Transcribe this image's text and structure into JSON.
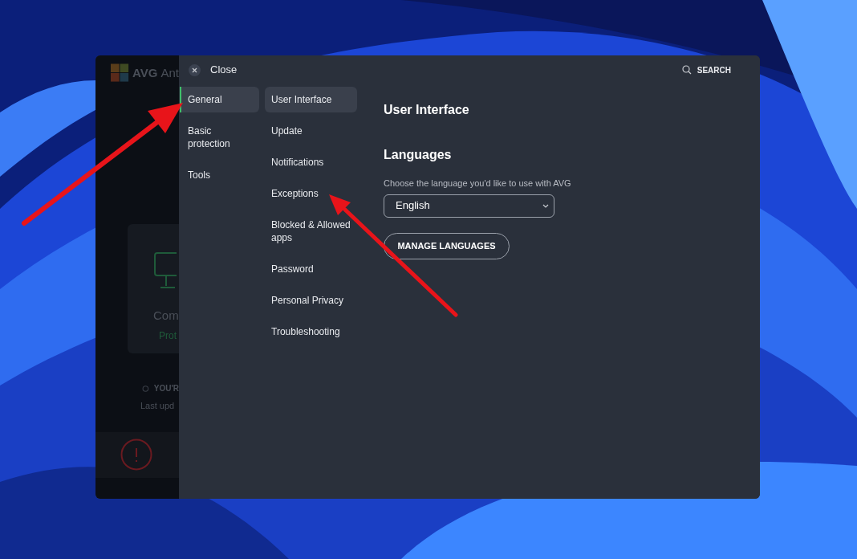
{
  "background_app": {
    "logo_text": "AVG",
    "title": "Ant",
    "status_title": "Com",
    "status_subtitle": "Prot",
    "update_status": "YOU'R",
    "last_update": "Last upd"
  },
  "header": {
    "close_label": "Close",
    "search_label": "SEARCH"
  },
  "categories": [
    {
      "label": "General",
      "selected": true
    },
    {
      "label": "Basic protection",
      "selected": false
    },
    {
      "label": "Tools",
      "selected": false
    }
  ],
  "subcategories": [
    {
      "label": "User Interface",
      "selected": true
    },
    {
      "label": "Update",
      "selected": false
    },
    {
      "label": "Notifications",
      "selected": false
    },
    {
      "label": "Exceptions",
      "selected": false
    },
    {
      "label": "Blocked & Allowed apps",
      "selected": false
    },
    {
      "label": "Password",
      "selected": false
    },
    {
      "label": "Personal Privacy",
      "selected": false
    },
    {
      "label": "Troubleshooting",
      "selected": false
    }
  ],
  "content": {
    "title": "User Interface",
    "section_title": "Languages",
    "description": "Choose the language you'd like to use with AVG",
    "language_value": "English",
    "manage_button": "MANAGE LANGUAGES"
  }
}
